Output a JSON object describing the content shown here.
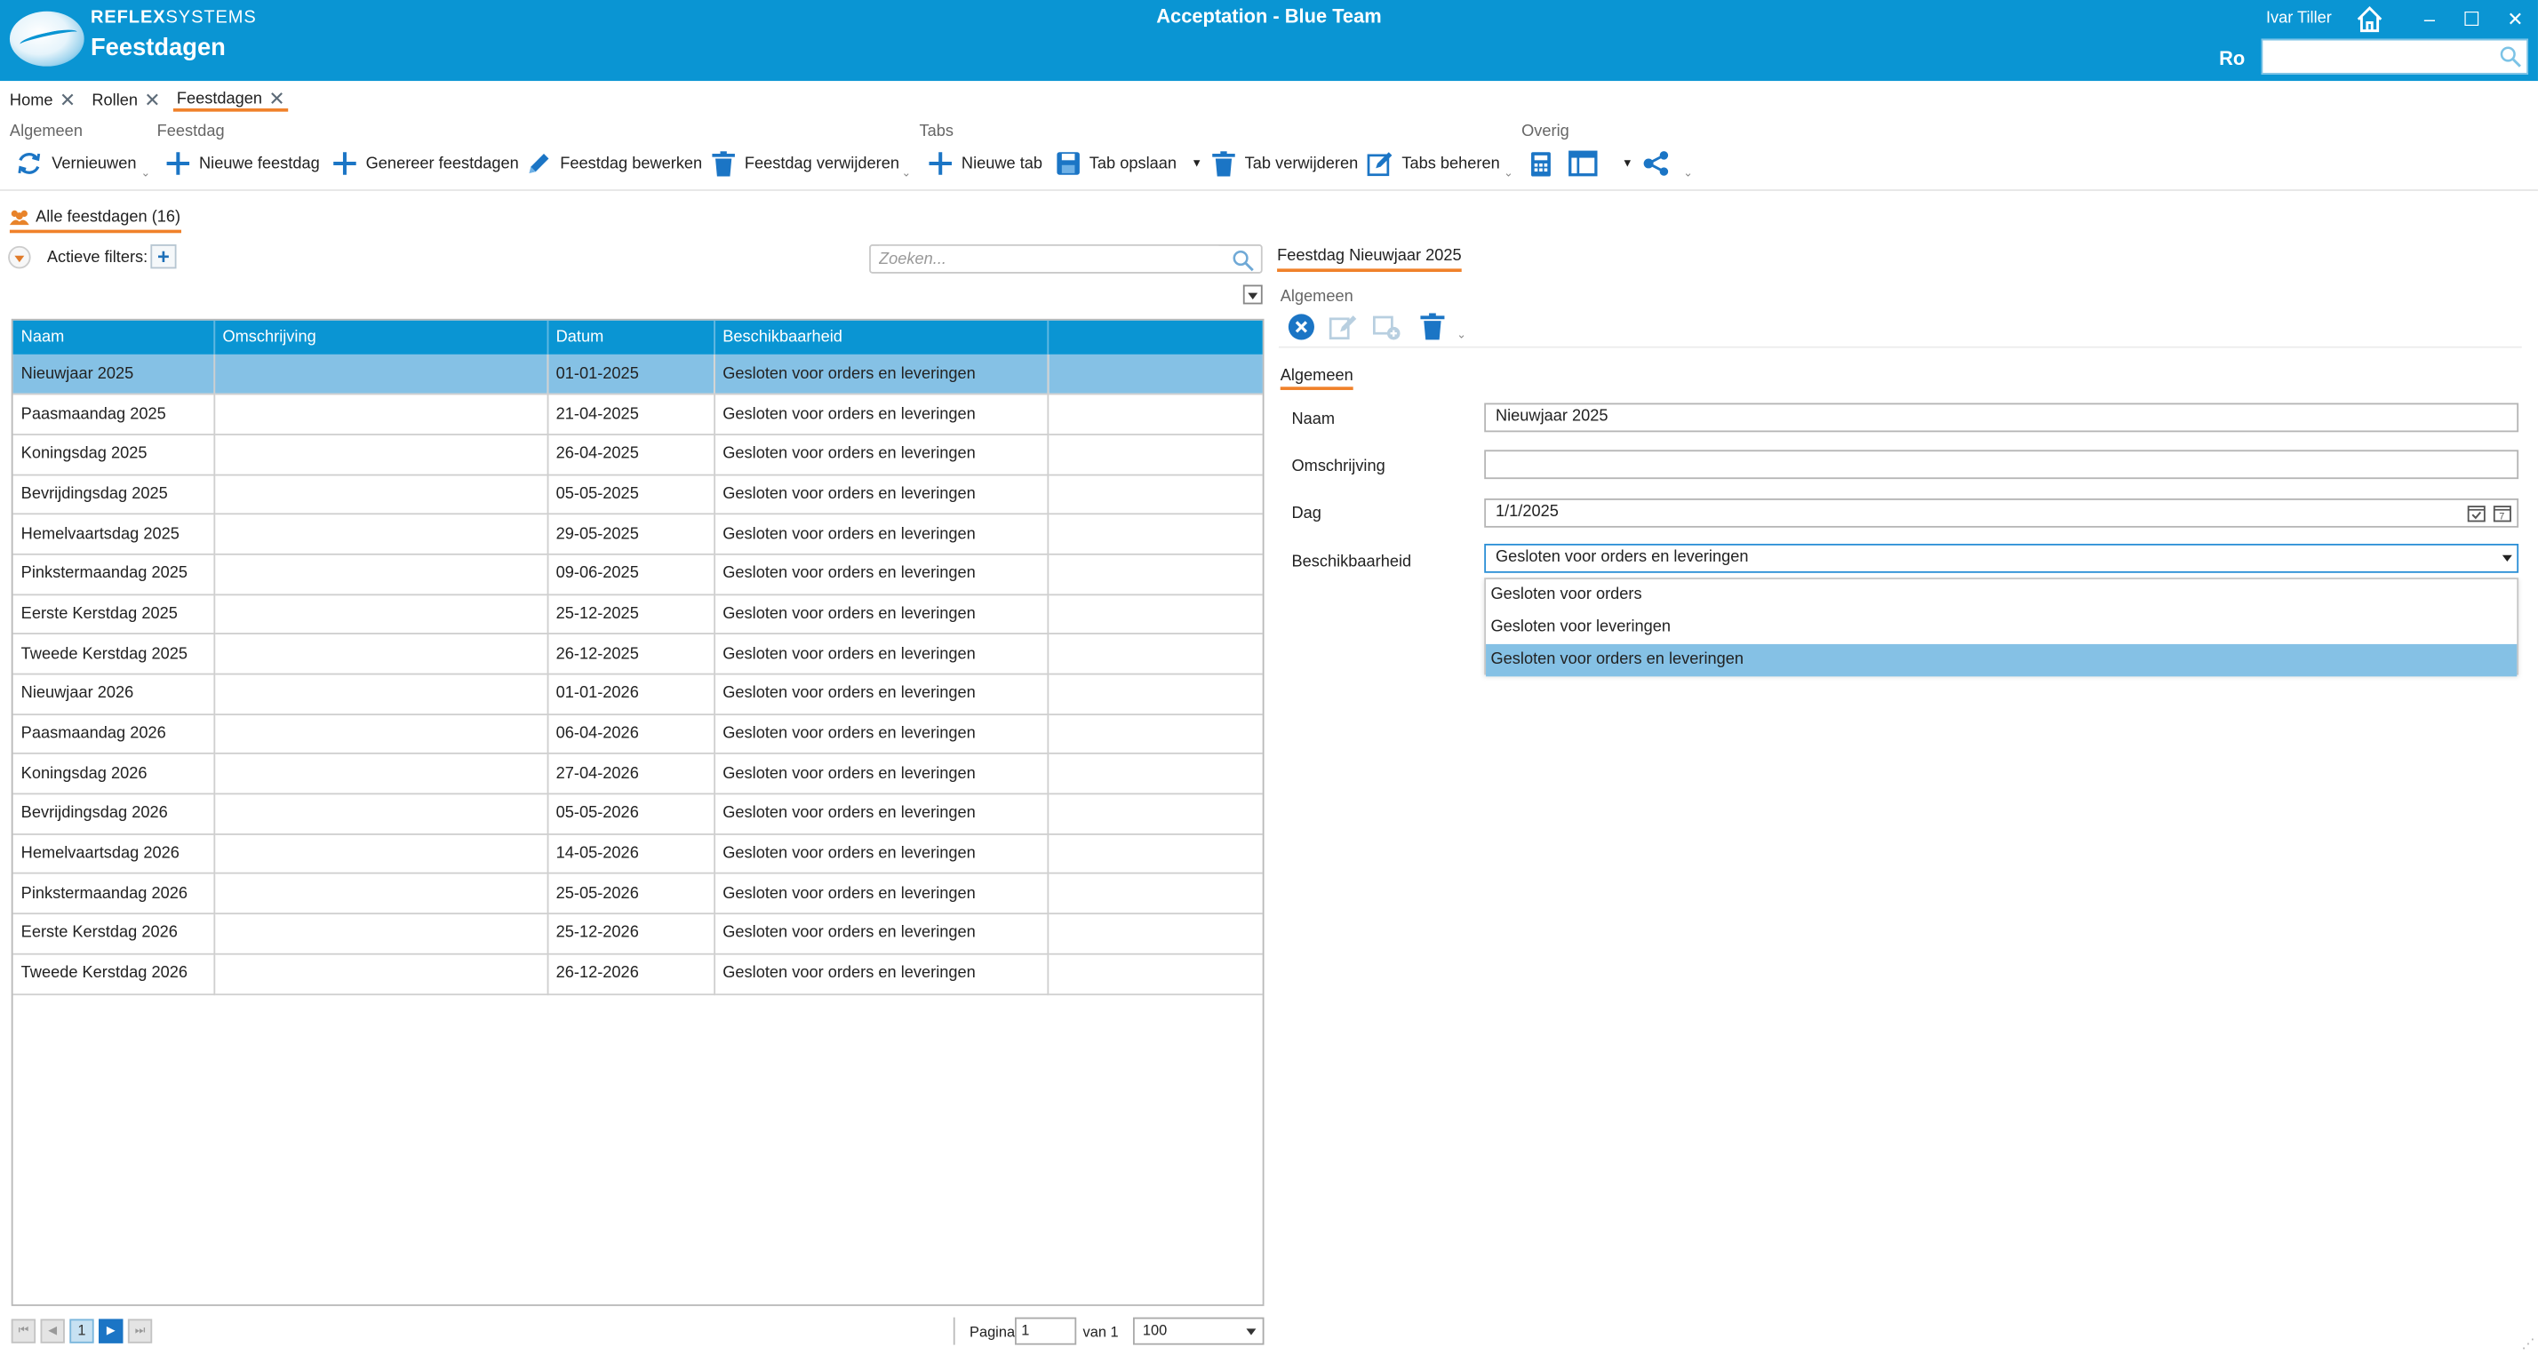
{
  "window": {
    "brand_bold": "REFLEX",
    "brand_light": "SYSTEMS",
    "app_title": "Feestdagen",
    "environment": "Acceptation - Blue Team",
    "user": "Ivar Tiller",
    "initials": "Ro",
    "minimize": "–",
    "maximize": "☐",
    "close": "✕"
  },
  "doc_tabs": [
    {
      "label": "Home",
      "active": false
    },
    {
      "label": "Rollen",
      "active": false
    },
    {
      "label": "Feestdagen",
      "active": true
    }
  ],
  "ribbon": {
    "groups": {
      "algemeen": "Algemeen",
      "feestdag": "Feestdag",
      "tabs": "Tabs",
      "overig": "Overig"
    },
    "buttons": {
      "refresh": "Vernieuwen",
      "new_holiday": "Nieuwe feestdag",
      "generate": "Genereer feestdagen",
      "edit": "Feestdag bewerken",
      "delete": "Feestdag verwijderen",
      "new_tab": "Nieuwe tab",
      "save_tab": "Tab opslaan",
      "delete_tab": "Tab verwijderen",
      "manage_tabs": "Tabs beheren"
    }
  },
  "list": {
    "header": "Alle feestdagen (16)",
    "filters_label": "Actieve filters:",
    "add_filter": "+",
    "search_placeholder": "Zoeken...",
    "columns": [
      "Naam",
      "Omschrijving",
      "Datum",
      "Beschikbaarheid",
      ""
    ],
    "rows": [
      {
        "naam": "Nieuwjaar 2025",
        "omschrijving": "",
        "datum": "01-01-2025",
        "beschikbaarheid": "Gesloten voor orders en leveringen",
        "selected": true
      },
      {
        "naam": "Paasmaandag 2025",
        "omschrijving": "",
        "datum": "21-04-2025",
        "beschikbaarheid": "Gesloten voor orders en leveringen"
      },
      {
        "naam": "Koningsdag 2025",
        "omschrijving": "",
        "datum": "26-04-2025",
        "beschikbaarheid": "Gesloten voor orders en leveringen"
      },
      {
        "naam": "Bevrijdingsdag 2025",
        "omschrijving": "",
        "datum": "05-05-2025",
        "beschikbaarheid": "Gesloten voor orders en leveringen"
      },
      {
        "naam": "Hemelvaartsdag 2025",
        "omschrijving": "",
        "datum": "29-05-2025",
        "beschikbaarheid": "Gesloten voor orders en leveringen"
      },
      {
        "naam": "Pinkstermaandag 2025",
        "omschrijving": "",
        "datum": "09-06-2025",
        "beschikbaarheid": "Gesloten voor orders en leveringen"
      },
      {
        "naam": "Eerste Kerstdag 2025",
        "omschrijving": "",
        "datum": "25-12-2025",
        "beschikbaarheid": "Gesloten voor orders en leveringen"
      },
      {
        "naam": "Tweede Kerstdag 2025",
        "omschrijving": "",
        "datum": "26-12-2025",
        "beschikbaarheid": "Gesloten voor orders en leveringen"
      },
      {
        "naam": "Nieuwjaar 2026",
        "omschrijving": "",
        "datum": "01-01-2026",
        "beschikbaarheid": "Gesloten voor orders en leveringen"
      },
      {
        "naam": "Paasmaandag 2026",
        "omschrijving": "",
        "datum": "06-04-2026",
        "beschikbaarheid": "Gesloten voor orders en leveringen"
      },
      {
        "naam": "Koningsdag 2026",
        "omschrijving": "",
        "datum": "27-04-2026",
        "beschikbaarheid": "Gesloten voor orders en leveringen"
      },
      {
        "naam": "Bevrijdingsdag 2026",
        "omschrijving": "",
        "datum": "05-05-2026",
        "beschikbaarheid": "Gesloten voor orders en leveringen"
      },
      {
        "naam": "Hemelvaartsdag 2026",
        "omschrijving": "",
        "datum": "14-05-2026",
        "beschikbaarheid": "Gesloten voor orders en leveringen"
      },
      {
        "naam": "Pinkstermaandag 2026",
        "omschrijving": "",
        "datum": "25-05-2026",
        "beschikbaarheid": "Gesloten voor orders en leveringen"
      },
      {
        "naam": "Eerste Kerstdag 2026",
        "omschrijving": "",
        "datum": "25-12-2026",
        "beschikbaarheid": "Gesloten voor orders en leveringen"
      },
      {
        "naam": "Tweede Kerstdag 2026",
        "omschrijving": "",
        "datum": "26-12-2026",
        "beschikbaarheid": "Gesloten voor orders en leveringen"
      }
    ]
  },
  "pager": {
    "current_page_button": "1",
    "page_label": "Pagina",
    "page_value": "1",
    "of_label": "van 1",
    "page_size": "100"
  },
  "detail": {
    "title": "Feestdag Nieuwjaar 2025",
    "toolbar_group": "Algemeen",
    "section": "Algemeen",
    "labels": {
      "naam": "Naam",
      "omschrijving": "Omschrijving",
      "dag": "Dag",
      "beschikbaarheid": "Beschikbaarheid"
    },
    "values": {
      "naam": "Nieuwjaar 2025",
      "omschrijving": "",
      "dag": "1/1/2025",
      "beschikbaarheid": "Gesloten voor orders en leveringen"
    },
    "options": [
      {
        "label": "Gesloten voor orders",
        "selected": false
      },
      {
        "label": "Gesloten voor leveringen",
        "selected": false
      },
      {
        "label": "Gesloten voor orders en leveringen",
        "selected": true
      }
    ]
  },
  "colors": {
    "accent": "#0a95d3",
    "selection": "#85c1e5",
    "underline": "#f0812a",
    "icon_blue": "#1b75c5"
  }
}
